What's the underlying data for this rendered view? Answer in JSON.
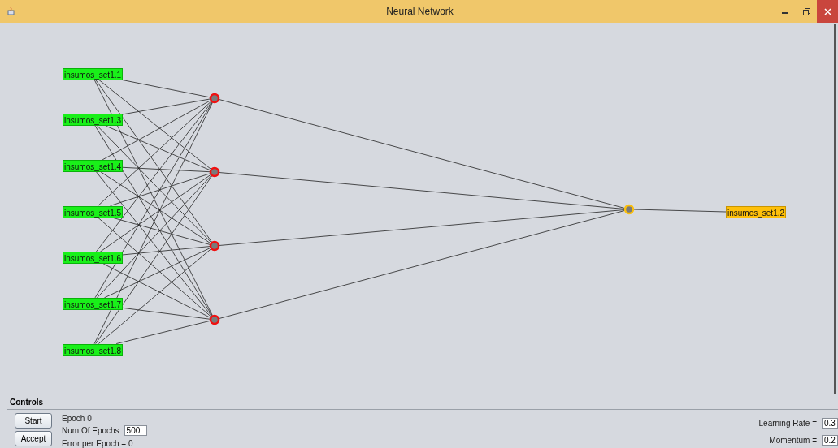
{
  "window": {
    "title": "Neural Network"
  },
  "network": {
    "inputs": [
      {
        "label": "insumos_set1.1"
      },
      {
        "label": "insumos_set1.3"
      },
      {
        "label": "insumos_set1.4"
      },
      {
        "label": "insumos_set1.5"
      },
      {
        "label": "insumos_set1.6"
      },
      {
        "label": "insumos_set1.7"
      },
      {
        "label": "insumos_set1.8"
      }
    ],
    "hidden_layer": [
      {
        "kind": "neuron"
      },
      {
        "kind": "neuron"
      },
      {
        "kind": "neuron"
      },
      {
        "kind": "neuron"
      }
    ],
    "output_layer": [
      {
        "kind": "neuron"
      }
    ],
    "outputs": [
      {
        "label": "insumos_set1.2"
      }
    ]
  },
  "controls": {
    "title": "Controls",
    "buttons": [
      "Start",
      "Accept"
    ],
    "epoch": "Epoch  0",
    "num_epochs_label": "Num Of Epochs",
    "num_epochs": "500",
    "error": "Error per Epoch = 0",
    "learning_rate_label": "Learning Rate =",
    "learning_rate": "0.3",
    "momentum_label": "Momentum =",
    "momentum": "0.2"
  }
}
